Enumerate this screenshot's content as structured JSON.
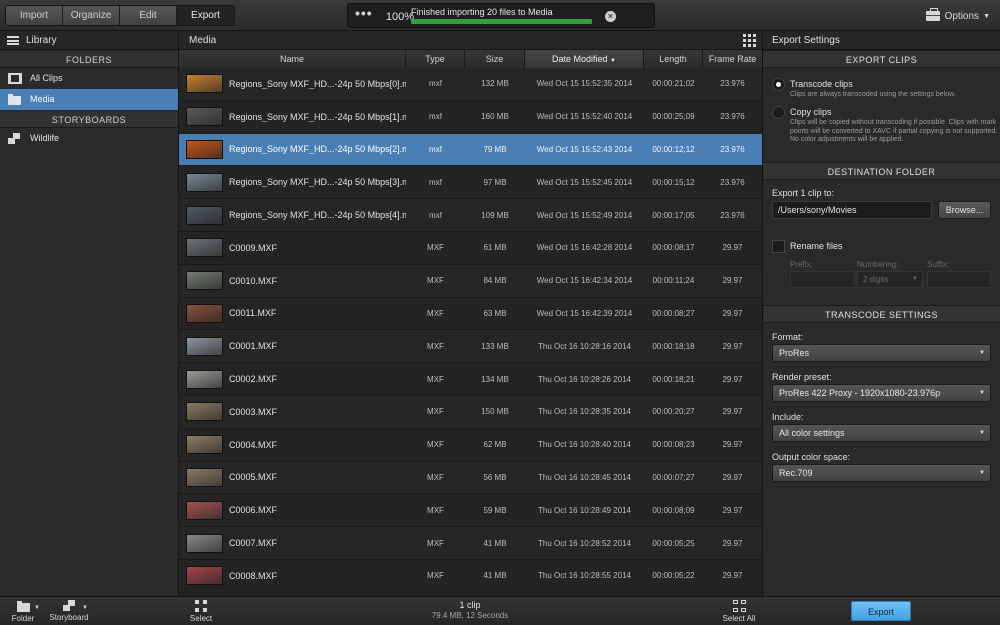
{
  "toolbar": {
    "modes": [
      "Import",
      "Organize",
      "Edit",
      "Export"
    ],
    "active_mode": "Export",
    "progress": {
      "percent_label": "100%",
      "percent": 100,
      "message": "Finished importing 20 files to Media"
    },
    "options_label": "Options"
  },
  "library": {
    "title": "Library",
    "folders_heading": "FOLDERS",
    "folders": [
      {
        "label": "All Clips",
        "icon": "film-icon"
      },
      {
        "label": "Media",
        "icon": "folder-icon",
        "selected": true
      }
    ],
    "storyboards_heading": "STORYBOARDS",
    "storyboards": [
      {
        "label": "Wildlife",
        "icon": "storyboard-icon"
      }
    ]
  },
  "media": {
    "title": "Media",
    "columns": [
      "Name",
      "Type",
      "Size",
      "Date Modified",
      "Length",
      "Frame Rate"
    ],
    "sorted_column": "Date Modified",
    "clips": [
      {
        "name": "Regions_Sony MXF_HD...-24p 50 Mbps[0].mxf",
        "type": "mxf",
        "size": "132 MB",
        "date": "Wed Oct 15 15:52:35 2014",
        "length": "00:00:21;02",
        "fps": "23.976",
        "thumb": "#c9822c"
      },
      {
        "name": "Regions_Sony MXF_HD...-24p 50 Mbps[1].mxf",
        "type": "mxf",
        "size": "160 MB",
        "date": "Wed Oct 15 15:52:40 2014",
        "length": "00:00:25;09",
        "fps": "23.976",
        "thumb": "#5a5a58"
      },
      {
        "name": "Regions_Sony MXF_HD...-24p 50 Mbps[2].mxf",
        "type": "mxf",
        "size": "79 MB",
        "date": "Wed Oct 15 15:52:43 2014",
        "length": "00:00:12;12",
        "fps": "23.976",
        "thumb": "#c6551d",
        "selected": true
      },
      {
        "name": "Regions_Sony MXF_HD...-24p 50 Mbps[3].mxf",
        "type": "mxf",
        "size": "97 MB",
        "date": "Wed Oct 15 15:52:45 2014",
        "length": "00:00:15;12",
        "fps": "23.976",
        "thumb": "#7a8796"
      },
      {
        "name": "Regions_Sony MXF_HD...-24p 50 Mbps[4].mxf",
        "type": "mxf",
        "size": "109 MB",
        "date": "Wed Oct 15 15:52:49 2014",
        "length": "00:00:17;05",
        "fps": "23.976",
        "thumb": "#4d5962"
      },
      {
        "name": "C0009.MXF",
        "type": "MXF",
        "size": "61 MB",
        "date": "Wed Oct 15 16:42:28 2014",
        "length": "00:00:08;17",
        "fps": "29.97",
        "thumb": "#6d7275"
      },
      {
        "name": "C0010.MXF",
        "type": "MXF",
        "size": "84 MB",
        "date": "Wed Oct 15 16:42:34 2014",
        "length": "00:00:11;24",
        "fps": "29.97",
        "thumb": "#737a70"
      },
      {
        "name": "C0011.MXF",
        "type": "MXF",
        "size": "63 MB",
        "date": "Wed Oct 15 16:42:39 2014",
        "length": "00:00:08;27",
        "fps": "29.97",
        "thumb": "#8a4e40"
      },
      {
        "name": "C0001.MXF",
        "type": "MXF",
        "size": "133 MB",
        "date": "Thu Oct 16 10:28:16 2014",
        "length": "00:00:18;18",
        "fps": "29.97",
        "thumb": "#8d96a3"
      },
      {
        "name": "C0002.MXF",
        "type": "MXF",
        "size": "134 MB",
        "date": "Thu Oct 16 10:28:26 2014",
        "length": "00:00:18;21",
        "fps": "29.97",
        "thumb": "#9b9a96"
      },
      {
        "name": "C0003.MXF",
        "type": "MXF",
        "size": "150 MB",
        "date": "Thu Oct 16 10:28:35 2014",
        "length": "00:00:20;27",
        "fps": "29.97",
        "thumb": "#8a7a62"
      },
      {
        "name": "C0004.MXF",
        "type": "MXF",
        "size": "62 MB",
        "date": "Thu Oct 16 10:28:40 2014",
        "length": "00:00:08;23",
        "fps": "29.97",
        "thumb": "#8f7d63"
      },
      {
        "name": "C0005.MXF",
        "type": "MXF",
        "size": "56 MB",
        "date": "Thu Oct 16 10:28:45 2014",
        "length": "00:00:07;27",
        "fps": "29.97",
        "thumb": "#8a7c66"
      },
      {
        "name": "C0006.MXF",
        "type": "MXF",
        "size": "59 MB",
        "date": "Thu Oct 16 10:28:49 2014",
        "length": "00:00:08;09",
        "fps": "29.97",
        "thumb": "#a4524e"
      },
      {
        "name": "C0007.MXF",
        "type": "MXF",
        "size": "41 MB",
        "date": "Thu Oct 16 10:28:52 2014",
        "length": "00:00:05;25",
        "fps": "29.97",
        "thumb": "#8c8a88"
      },
      {
        "name": "C0008.MXF",
        "type": "MXF",
        "size": "41 MB",
        "date": "Thu Oct 16 10:28:55 2014",
        "length": "00:00:05;22",
        "fps": "29.97",
        "thumb": "#a4434c"
      }
    ]
  },
  "export_settings": {
    "title": "Export Settings",
    "export_clips_heading": "EXPORT CLIPS",
    "transcode_label": "Transcode clips",
    "transcode_note": "Clips are always transcoded using the settings below.",
    "copy_label": "Copy clips",
    "copy_note": "Clips will be copied without transcoding if possible. Clips with mark points will be converted to XAVC if partial copying is not supported. No color adjustments will be applied.",
    "destination_heading": "DESTINATION FOLDER",
    "export_to_label": "Export 1 clip to:",
    "path": "/Users/sony/Movies",
    "browse_label": "Browse...",
    "rename_label": "Rename files",
    "prefix_label": "Prefix:",
    "numbering_label": "Numbering:",
    "numbering_value": "2 digits",
    "suffix_label": "Suffix:",
    "transcode_heading": "TRANSCODE SETTINGS",
    "format_label": "Format:",
    "format_value": "ProRes",
    "preset_label": "Render preset:",
    "preset_value": "ProRes 422 Proxy - 1920x1080-23.976p",
    "include_label": "Include:",
    "include_value": "All color settings",
    "colorspace_label": "Output color space:",
    "colorspace_value": "Rec.709"
  },
  "bottom": {
    "folder_label": "Folder",
    "storyboard_label": "Storyboard",
    "select_label": "Select",
    "clip_count": "1 clip",
    "clip_info": "79.4 MB, 12 Seconds",
    "select_all_label": "Select All",
    "export_label": "Export"
  }
}
